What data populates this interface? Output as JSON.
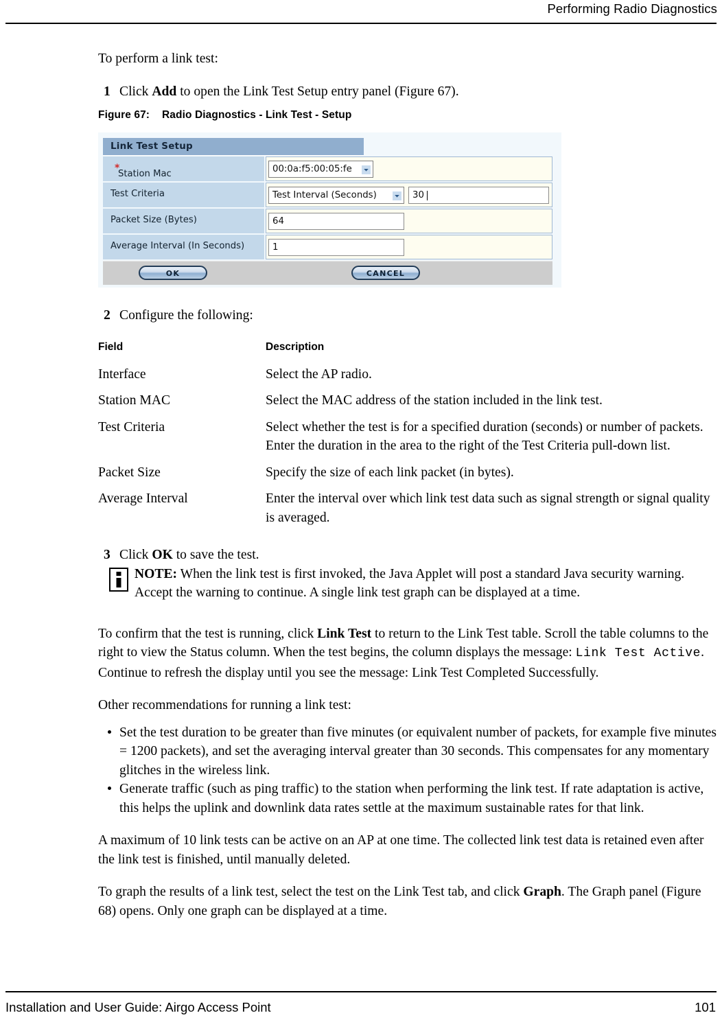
{
  "header": {
    "title": "Performing Radio Diagnostics"
  },
  "intro": {
    "lead": "To perform a link test:",
    "step1": {
      "number": "1",
      "pre": "Click ",
      "bold": "Add",
      "post": " to open the Link Test Setup entry panel (Figure 67)."
    }
  },
  "figure": {
    "caption_number": "Figure 67:",
    "caption_title": "Radio Diagnostics - Link Test - Setup",
    "panel": {
      "title": "Link Test Setup",
      "required_marker": "*",
      "rows": [
        {
          "label": "Station Mac",
          "required": true,
          "widget": "select",
          "value": "00:0a:f5:00:05:fe"
        },
        {
          "label": "Test Criteria",
          "required": false,
          "widget": "select+text",
          "value": "Test Interval (Seconds)",
          "value2": "30"
        },
        {
          "label": "Packet Size (Bytes)",
          "required": false,
          "widget": "text",
          "value": "64"
        },
        {
          "label": "Average Interval (In Seconds)",
          "required": false,
          "widget": "text",
          "value": "1"
        }
      ],
      "ok_label": "OK",
      "cancel_label": "CANCEL",
      "colors": {
        "titlebar": "#90aece",
        "label_cell": "#c3d8ea",
        "value_cell": "#fefdf0",
        "button_bar": "#cdcdcd",
        "figure_bg": "#f2f8fc",
        "required_star": "#d12b2b"
      }
    }
  },
  "step2": {
    "number": "2",
    "text": "Configure the following:"
  },
  "fields_table": {
    "headers": [
      "Field",
      "Description"
    ],
    "rows": [
      {
        "field": "Interface",
        "description": "Select the AP radio."
      },
      {
        "field": "Station MAC",
        "description": "Select the MAC address of the station included in the link test."
      },
      {
        "field": "Test Criteria",
        "description": "Select whether the test is for a specified duration (seconds) or number of packets. Enter the duration in the area to the right of the Test Criteria pull-down list."
      },
      {
        "field": "Packet Size",
        "description": "Specify the size of each link packet (in bytes)."
      },
      {
        "field": "Average Interval",
        "description": "Enter the interval over which link test data such as signal strength or signal quality is averaged."
      }
    ]
  },
  "step3": {
    "number": "3",
    "pre": "Click ",
    "bold": "OK",
    "post": " to save the test."
  },
  "note": {
    "icon": "info-icon",
    "label": "NOTE:",
    "text": " When the link test is first invoked, the Java Applet will post a standard Java security warning. Accept the warning to continue. A single link test graph can be displayed at a time."
  },
  "paragraphs": {
    "confirm_p1": "To confirm that the test is running, click ",
    "confirm_b1": "Link Test",
    "confirm_p2": " to return to the Link Test table. Scroll the table columns to the right to view the Status column. When the test begins, the column displays the message: ",
    "confirm_mono": "Link Test Active",
    "confirm_p3": ". Continue to refresh the display until you see the message: Link Test Completed Successfully.",
    "other_rec": "Other recommendations for running a link test:",
    "max_tests": "A maximum of 10 link tests can be active on an AP at one time. The collected link test data is retained even after the link test is finished, until manually deleted.",
    "graph_p1": "To graph the results of a link test, select the test on the Link Test tab, and click ",
    "graph_b1": "Graph",
    "graph_p2": ". The Graph panel (Figure 68) opens. Only one graph can be displayed at a time."
  },
  "bullets": [
    "Set the test duration to be greater than five minutes (or equivalent number of packets, for example five minutes = 1200 packets), and set the averaging interval greater than 30 seconds. This compensates for any momentary glitches in the wireless link.",
    "Generate traffic (such as ping traffic) to the station when performing the link test. If rate adaptation is active, this helps the uplink and downlink data rates settle at the maximum sustainable rates for that link."
  ],
  "footer": {
    "left": "Installation and User Guide: Airgo Access Point",
    "page_number": "101"
  }
}
